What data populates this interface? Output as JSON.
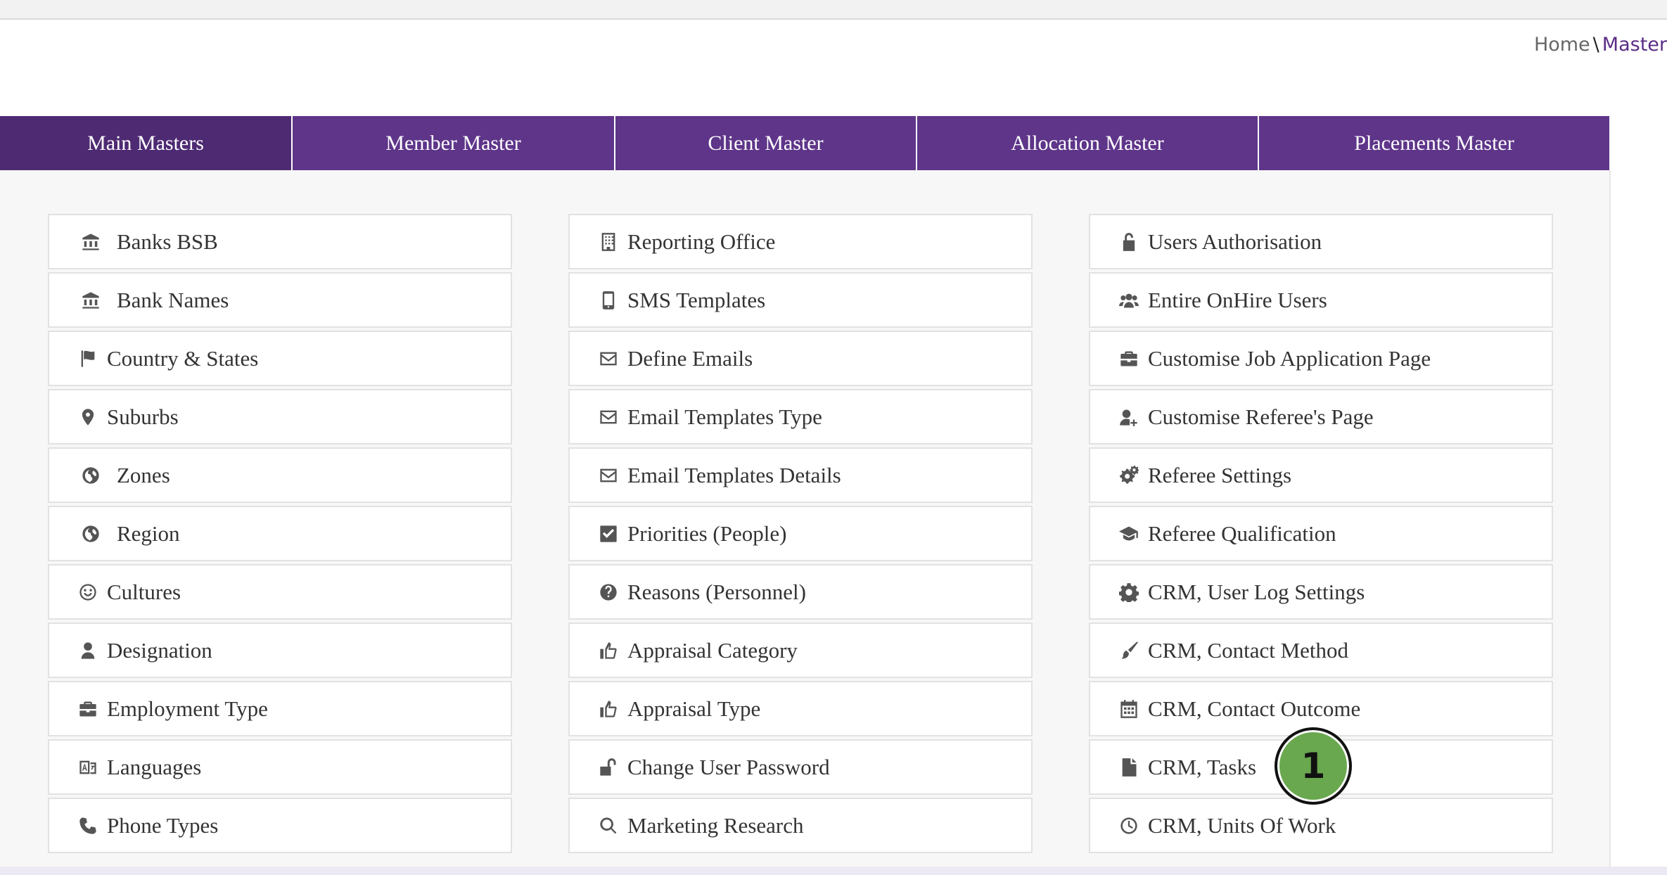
{
  "breadcrumb": {
    "home": "Home",
    "separator": "\\",
    "current": "Master"
  },
  "tabs": [
    {
      "label": "Main Masters",
      "active": true
    },
    {
      "label": "Member Master",
      "active": false
    },
    {
      "label": "Client Master",
      "active": false
    },
    {
      "label": "Allocation Master",
      "active": false
    },
    {
      "label": "Placements Master",
      "active": false
    }
  ],
  "columns": [
    {
      "items": [
        {
          "label": "Banks BSB",
          "icon": "bank-icon"
        },
        {
          "label": "Bank Names",
          "icon": "bank-icon"
        },
        {
          "label": "Country & States",
          "icon": "flag-icon"
        },
        {
          "label": "Suburbs",
          "icon": "map-marker-icon"
        },
        {
          "label": "Zones",
          "icon": "globe-icon"
        },
        {
          "label": "Region",
          "icon": "globe-icon"
        },
        {
          "label": "Cultures",
          "icon": "smile-icon"
        },
        {
          "label": "Designation",
          "icon": "user-icon"
        },
        {
          "label": "Employment Type",
          "icon": "briefcase-icon"
        },
        {
          "label": "Languages",
          "icon": "language-icon"
        },
        {
          "label": "Phone Types",
          "icon": "phone-icon"
        }
      ]
    },
    {
      "items": [
        {
          "label": "Reporting Office",
          "icon": "building-icon"
        },
        {
          "label": "SMS Templates",
          "icon": "mobile-icon"
        },
        {
          "label": "Define Emails",
          "icon": "envelope-icon"
        },
        {
          "label": "Email Templates Type",
          "icon": "envelope-icon"
        },
        {
          "label": "Email Templates Details",
          "icon": "envelope-icon"
        },
        {
          "label": "Priorities (People)",
          "icon": "check-square-icon"
        },
        {
          "label": "Reasons (Personnel)",
          "icon": "question-circle-icon"
        },
        {
          "label": "Appraisal Category",
          "icon": "thumbs-up-icon"
        },
        {
          "label": "Appraisal Type",
          "icon": "thumbs-up-icon"
        },
        {
          "label": "Change User Password",
          "icon": "unlock-icon"
        },
        {
          "label": "Marketing Research",
          "icon": "search-icon"
        }
      ]
    },
    {
      "items": [
        {
          "label": "Users Authorisation",
          "icon": "unlock-alt-icon"
        },
        {
          "label": "Entire OnHire Users",
          "icon": "users-icon"
        },
        {
          "label": "Customise Job Application Page",
          "icon": "briefcase-icon"
        },
        {
          "label": "Customise Referee's Page",
          "icon": "user-plus-icon"
        },
        {
          "label": "Referee Settings",
          "icon": "cogs-icon"
        },
        {
          "label": "Referee Qualification",
          "icon": "graduation-cap-icon"
        },
        {
          "label": "CRM, User Log Settings",
          "icon": "cog-icon"
        },
        {
          "label": "CRM, Contact Method",
          "icon": "paint-brush-icon"
        },
        {
          "label": "CRM, Contact Outcome",
          "icon": "calendar-icon"
        },
        {
          "label": "CRM, Tasks",
          "icon": "file-icon"
        },
        {
          "label": "CRM, Units Of Work",
          "icon": "clock-icon"
        }
      ]
    }
  ],
  "step_marker": {
    "label": "1",
    "color": "#6aa84f"
  }
}
